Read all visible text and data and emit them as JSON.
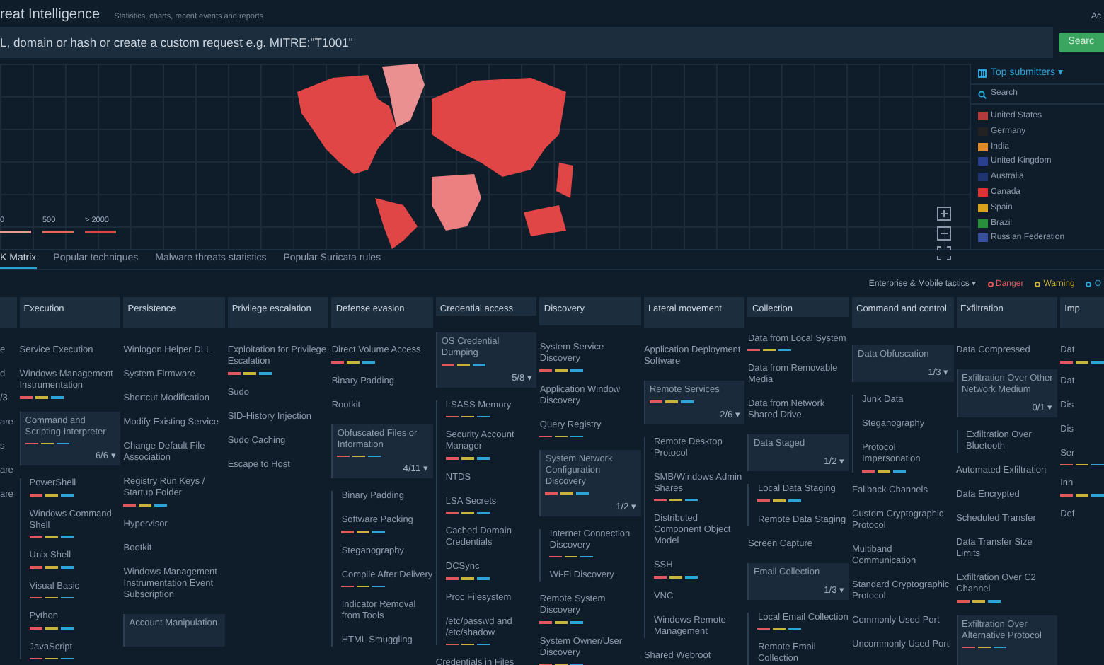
{
  "header": {
    "title": "reat Intelligence",
    "subtitle": "Statistics, charts, recent events and reports",
    "account": "Ac"
  },
  "search": {
    "placeholder": "L, domain or hash or create a custom request e.g. MITRE:\"T1001\"",
    "button": "Searc"
  },
  "map": {
    "legend": [
      {
        "label": "0",
        "color": "#eb9a9a"
      },
      {
        "label": "500",
        "color": "#e56565"
      },
      {
        "label": "> 2000",
        "color": "#d94444"
      }
    ]
  },
  "submitters": {
    "title": "Top submitters ▾",
    "search_placeholder": "Search",
    "countries": [
      "United States",
      "Germany",
      "India",
      "United Kingdom",
      "Australia",
      "Canada",
      "Spain",
      "Brazil",
      "Russian Federation"
    ]
  },
  "tabs": [
    {
      "label": "K Matrix",
      "selected": true
    },
    {
      "label": "Popular techniques",
      "selected": false
    },
    {
      "label": "Malware threats statistics",
      "selected": false
    },
    {
      "label": "Popular Suricata rules",
      "selected": false
    }
  ],
  "filters": {
    "tactics": "Enterprise & Mobile tactics ▾",
    "legend": [
      {
        "label": "Danger",
        "color": "#e0585b"
      },
      {
        "label": "Warning",
        "color": "#c9b33a"
      },
      {
        "label": "O",
        "color": "#2ea3d6"
      }
    ]
  },
  "matrix": {
    "columns": [
      {
        "items": [
          {
            "kind": "technique",
            "label": "e",
            "bars": false
          },
          {
            "kind": "technique",
            "label": "d",
            "bars": false
          },
          {
            "kind": "technique",
            "label": "/3",
            "bars": false
          },
          {
            "kind": "technique",
            "label": "are",
            "bars": false
          },
          {
            "kind": "technique",
            "label": "s",
            "bars": false
          },
          {
            "kind": "technique",
            "label": "are",
            "bars": false
          },
          {
            "kind": "technique",
            "label": "are",
            "bars": false
          }
        ]
      },
      {
        "title": "Execution",
        "items": [
          {
            "kind": "technique",
            "label": "Service Execution",
            "bars": false
          },
          {
            "kind": "technique",
            "label": "Windows Management Instrumentation",
            "bars": true
          },
          {
            "kind": "group",
            "label": "Command and Scripting Interpreter",
            "bars": true,
            "count": "6/6 ▾",
            "children": [
              {
                "label": "PowerShell",
                "bars": true
              },
              {
                "label": "Windows Command Shell",
                "bars": true
              },
              {
                "label": "Unix Shell",
                "bars": true
              },
              {
                "label": "Visual Basic",
                "bars": true
              },
              {
                "label": "Python",
                "bars": true
              },
              {
                "label": "JavaScript",
                "bars": true
              }
            ]
          }
        ]
      },
      {
        "title": "Persistence",
        "items": [
          {
            "kind": "technique",
            "label": "Winlogon Helper DLL",
            "bars": false
          },
          {
            "kind": "technique",
            "label": "System Firmware",
            "bars": false
          },
          {
            "kind": "technique",
            "label": "Shortcut Modification",
            "bars": false
          },
          {
            "kind": "technique",
            "label": "Modify Existing Service",
            "bars": false
          },
          {
            "kind": "technique",
            "label": "Change Default File Association",
            "bars": false
          },
          {
            "kind": "technique",
            "label": "Registry Run Keys / Startup Folder",
            "bars": true
          },
          {
            "kind": "technique",
            "label": "Hypervisor",
            "bars": false
          },
          {
            "kind": "technique",
            "label": "Bootkit",
            "bars": false
          },
          {
            "kind": "technique",
            "label": "Windows Management Instrumentation Event Subscription",
            "bars": false
          },
          {
            "kind": "group",
            "label": "Account Manipulation",
            "bars": false
          }
        ]
      },
      {
        "title": "Privilege escalation",
        "items": [
          {
            "kind": "technique",
            "label": "Exploitation for Privilege Escalation",
            "bars": true
          },
          {
            "kind": "technique",
            "label": "Sudo",
            "bars": false
          },
          {
            "kind": "technique",
            "label": "SID-History Injection",
            "bars": false
          },
          {
            "kind": "technique",
            "label": "Sudo Caching",
            "bars": false
          },
          {
            "kind": "technique",
            "label": "Escape to Host",
            "bars": false
          }
        ]
      },
      {
        "title": "Defense evasion",
        "items": [
          {
            "kind": "technique",
            "label": "Direct Volume Access",
            "bars": true
          },
          {
            "kind": "technique",
            "label": "Binary Padding",
            "bars": false
          },
          {
            "kind": "technique",
            "label": "Rootkit",
            "bars": false
          },
          {
            "kind": "group",
            "label": "Obfuscated Files or Information",
            "bars": true,
            "count": "4/11 ▾",
            "children": [
              {
                "label": "Binary Padding",
                "bars": false
              },
              {
                "label": "Software Packing",
                "bars": true
              },
              {
                "label": "Steganography",
                "bars": false
              },
              {
                "label": "Compile After Delivery",
                "bars": true
              },
              {
                "label": "Indicator Removal from Tools",
                "bars": false
              },
              {
                "label": "HTML Smuggling",
                "bars": false
              }
            ]
          }
        ]
      },
      {
        "title": "Credential access",
        "items": [
          {
            "kind": "group",
            "label": "OS Credential Dumping",
            "bars": true,
            "count": "5/8 ▾",
            "children": [
              {
                "label": "LSASS Memory",
                "bars": true
              },
              {
                "label": "Security Account Manager",
                "bars": true
              },
              {
                "label": "NTDS",
                "bars": false
              },
              {
                "label": "LSA Secrets",
                "bars": true
              },
              {
                "label": "Cached Domain Credentials",
                "bars": false
              },
              {
                "label": "DCSync",
                "bars": true
              },
              {
                "label": "Proc Filesystem",
                "bars": false
              },
              {
                "label": "/etc/passwd and /etc/shadow",
                "bars": true
              }
            ]
          },
          {
            "kind": "technique",
            "label": "Credentials in Files",
            "bars": false
          }
        ]
      },
      {
        "title": "Discovery",
        "items": [
          {
            "kind": "technique",
            "label": "System Service Discovery",
            "bars": true
          },
          {
            "kind": "technique",
            "label": "Application Window Discovery",
            "bars": false
          },
          {
            "kind": "technique",
            "label": "Query Registry",
            "bars": true
          },
          {
            "kind": "group",
            "label": "System Network Configuration Discovery",
            "bars": true,
            "count": "1/2 ▾",
            "children": [
              {
                "label": "Internet Connection Discovery",
                "bars": true
              },
              {
                "label": "Wi-Fi Discovery",
                "bars": false
              }
            ]
          },
          {
            "kind": "technique",
            "label": "Remote System Discovery",
            "bars": true
          },
          {
            "kind": "technique",
            "label": "System Owner/User Discovery",
            "bars": true
          }
        ]
      },
      {
        "title": "Lateral movement",
        "items": [
          {
            "kind": "technique",
            "label": "Application Deployment Software",
            "bars": false
          },
          {
            "kind": "group",
            "label": "Remote Services",
            "bars": true,
            "count": "2/6 ▾",
            "children": [
              {
                "label": "Remote Desktop Protocol",
                "bars": false
              },
              {
                "label": "SMB/Windows Admin Shares",
                "bars": true
              },
              {
                "label": "Distributed Component Object Model",
                "bars": false
              },
              {
                "label": "SSH",
                "bars": true
              },
              {
                "label": "VNC",
                "bars": false
              },
              {
                "label": "Windows Remote Management",
                "bars": false
              }
            ]
          },
          {
            "kind": "technique",
            "label": "Shared Webroot",
            "bars": false
          }
        ]
      },
      {
        "title": "Collection",
        "items": [
          {
            "kind": "technique",
            "label": "Data from Local System",
            "bars": true
          },
          {
            "kind": "technique",
            "label": "Data from Removable Media",
            "bars": false
          },
          {
            "kind": "technique",
            "label": "Data from Network Shared Drive",
            "bars": false
          },
          {
            "kind": "group",
            "label": "Data Staged",
            "bars": false,
            "count": "1/2 ▾",
            "children": [
              {
                "label": "Local Data Staging",
                "bars": true
              },
              {
                "label": "Remote Data Staging",
                "bars": false
              }
            ]
          },
          {
            "kind": "technique",
            "label": "Screen Capture",
            "bars": false
          },
          {
            "kind": "group",
            "label": "Email Collection",
            "bars": false,
            "count": "1/3 ▾",
            "children": [
              {
                "label": "Local Email Collection",
                "bars": true
              },
              {
                "label": "Remote Email Collection",
                "bars": false
              }
            ]
          }
        ]
      },
      {
        "title": "Command and control",
        "items": [
          {
            "kind": "group",
            "label": "Data Obfuscation",
            "bars": false,
            "count": "1/3 ▾",
            "children": [
              {
                "label": "Junk Data",
                "bars": false
              },
              {
                "label": "Steganography",
                "bars": false
              },
              {
                "label": "Protocol Impersonation",
                "bars": true
              }
            ]
          },
          {
            "kind": "technique",
            "label": "Fallback Channels",
            "bars": false
          },
          {
            "kind": "technique",
            "label": "Custom Cryptographic Protocol",
            "bars": false
          },
          {
            "kind": "technique",
            "label": "Multiband Communication",
            "bars": false
          },
          {
            "kind": "technique",
            "label": "Standard Cryptographic Protocol",
            "bars": false
          },
          {
            "kind": "technique",
            "label": "Commonly Used Port",
            "bars": false
          },
          {
            "kind": "technique",
            "label": "Uncommonly Used Port",
            "bars": false
          }
        ]
      },
      {
        "title": "Exfiltration",
        "items": [
          {
            "kind": "technique",
            "label": "Data Compressed",
            "bars": false
          },
          {
            "kind": "group",
            "label": "Exfiltration Over Other Network Medium",
            "bars": false,
            "count": "0/1 ▾",
            "children": [
              {
                "label": "Exfiltration Over Bluetooth",
                "bars": false
              }
            ]
          },
          {
            "kind": "technique",
            "label": "Automated Exfiltration",
            "bars": false
          },
          {
            "kind": "technique",
            "label": "Data Encrypted",
            "bars": false
          },
          {
            "kind": "technique",
            "label": "Scheduled Transfer",
            "bars": false
          },
          {
            "kind": "technique",
            "label": "Data Transfer Size Limits",
            "bars": false
          },
          {
            "kind": "technique",
            "label": "Exfiltration Over C2 Channel",
            "bars": true
          },
          {
            "kind": "group",
            "label": "Exfiltration Over Alternative Protocol",
            "bars": true
          }
        ]
      },
      {
        "title": "Imp",
        "items": [
          {
            "kind": "technique",
            "label": "Dat",
            "bars": true
          },
          {
            "kind": "technique",
            "label": "Dat",
            "bars": false
          },
          {
            "kind": "technique",
            "label": "Dis",
            "bars": false
          },
          {
            "kind": "technique",
            "label": "Dis",
            "bars": false
          },
          {
            "kind": "technique",
            "label": "Ser",
            "bars": true
          },
          {
            "kind": "technique",
            "label": "Inh",
            "bars": true
          },
          {
            "kind": "technique",
            "label": "Def",
            "bars": false
          }
        ]
      }
    ]
  }
}
